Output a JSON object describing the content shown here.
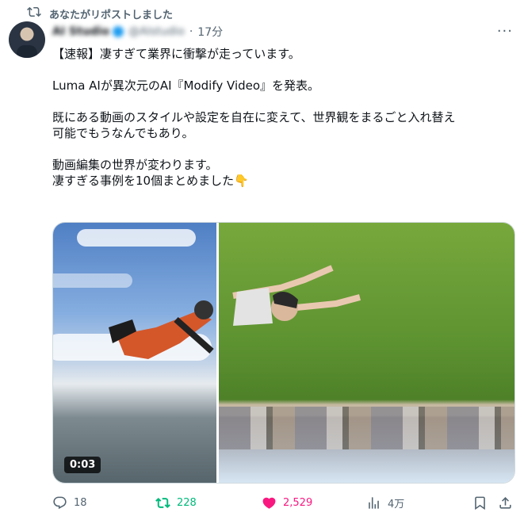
{
  "repost": {
    "text": "あなたがリポストしました",
    "icon": "repost-icon"
  },
  "header": {
    "name": "AI Studio",
    "handle": "@AIstudio",
    "separator": "·",
    "time": "17分",
    "more": "···"
  },
  "tweet": {
    "paragraphs": [
      "【速報】凄すぎて業界に衝撃が走っています。",
      "Luma AIが異次元のAI『Modify Video』を発表。",
      "既にある動画のスタイルや設定を自在に変えて、世界観をまるごと入れ替え\n可能でもうなんでもあり。",
      "動画編集の世界が変わります。\n 凄すぎる事例を10個まとめました👇"
    ]
  },
  "media": {
    "duration": "0:03"
  },
  "actions": {
    "replies": "18",
    "reposts": "228",
    "likes": "2,529",
    "views": "4万"
  },
  "colors": {
    "repost_active": "#00ba7c",
    "like_active": "#f91880",
    "muted": "#536471",
    "verified": "#1d9bf0"
  }
}
